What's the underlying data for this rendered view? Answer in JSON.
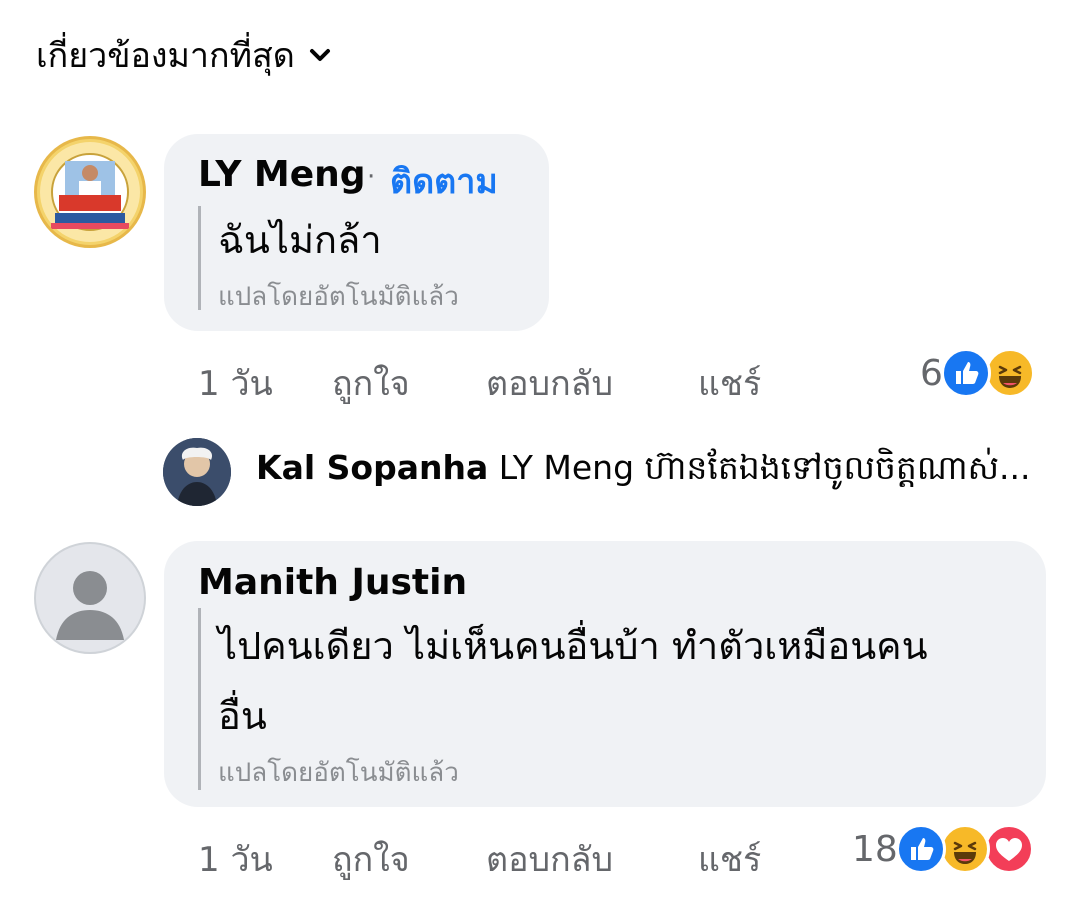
{
  "sort": {
    "label": "เกี่ยวข้องมากที่สุด",
    "icon": "chevron-down-icon"
  },
  "comments": [
    {
      "author": "LY Meng",
      "separator": "·",
      "follow": "ติดตาม",
      "text": "ฉันไม่กล้า",
      "translated": "แปลโดยอัตโนมัติแล้ว",
      "time": "1 วัน",
      "like": "ถูกใจ",
      "reply": "ตอบกลับ",
      "share": "แชร์",
      "reaction_count": "6",
      "reactions": [
        "like-icon",
        "haha-icon"
      ]
    },
    {
      "author": "Manith Justin",
      "text_line1": "ไปคนเดียว ไม่เห็นคนอื่นบ้า ทำตัวเหมือนคน",
      "text_line2": "อื่น",
      "translated": "แปลโดยอัตโนมัติแล้ว",
      "time": "1 วัน",
      "like": "ถูกใจ",
      "reply": "ตอบกลับ",
      "share": "แชร์",
      "reaction_count": "18",
      "reactions": [
        "like-icon",
        "haha-icon",
        "love-icon"
      ]
    }
  ],
  "reply_preview": {
    "author": "Kal Sopanha",
    "text": "LY Meng ហ៊ានតែឯងទៅចូលចិត្តណាស់..."
  },
  "colors": {
    "bubble": "#f0f2f5",
    "link": "#1877f2",
    "muted": "#65676b",
    "like": "#1877f2",
    "haha": "#f7b928",
    "love": "#f33e58"
  }
}
